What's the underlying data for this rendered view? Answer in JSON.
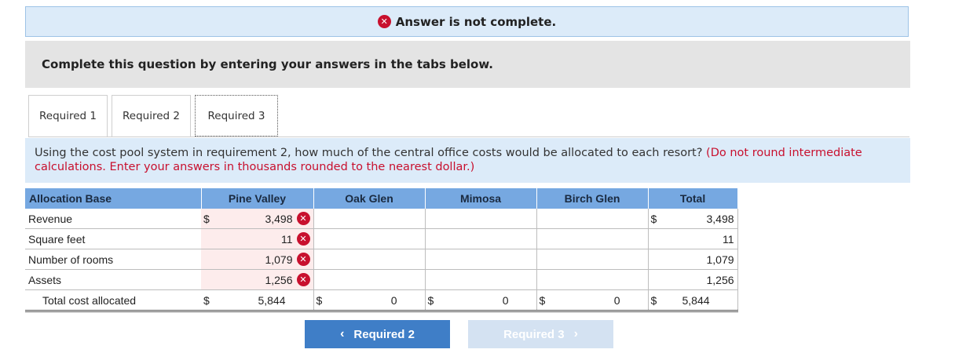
{
  "banner": {
    "text": "Answer is not complete."
  },
  "instruction": "Complete this question by entering your answers in the tabs below.",
  "tabs": [
    {
      "label": "Required 1"
    },
    {
      "label": "Required 2"
    },
    {
      "label": "Required 3",
      "active": true
    }
  ],
  "question": {
    "text": "Using the cost pool system in requirement 2, how much of the central office costs would be allocated to each resort?",
    "note": "(Do not round intermediate calculations. Enter your answers in thousands rounded to the nearest dollar.)"
  },
  "table": {
    "headers": [
      "Allocation Base",
      "Pine Valley",
      "Oak Glen",
      "Mimosa",
      "Birch Glen",
      "Total"
    ],
    "currency": "$",
    "rows": [
      {
        "label": "Revenue",
        "pine_valley": "3,498",
        "oak_glen": "",
        "mimosa": "",
        "birch_glen": "",
        "total": "3,498"
      },
      {
        "label": "Square feet",
        "pine_valley": "11",
        "oak_glen": "",
        "mimosa": "",
        "birch_glen": "",
        "total": "11"
      },
      {
        "label": "Number of rooms",
        "pine_valley": "1,079",
        "oak_glen": "",
        "mimosa": "",
        "birch_glen": "",
        "total": "1,079"
      },
      {
        "label": "Assets",
        "pine_valley": "1,256",
        "oak_glen": "",
        "mimosa": "",
        "birch_glen": "",
        "total": "1,256"
      }
    ],
    "total_row": {
      "label": "Total cost allocated",
      "pine_valley": "5,844",
      "oak_glen": "0",
      "mimosa": "0",
      "birch_glen": "0",
      "total": "5,844"
    }
  },
  "buttons": {
    "prev_label": "Required 2",
    "next_label": "Required 3"
  },
  "colors": {
    "error_red": "#c8102e",
    "header_blue": "#76a8e1",
    "banner_bg": "#dcebf9",
    "prev_button": "#3f7ec7",
    "next_button_disabled": "#d4e2f2"
  },
  "icons": {
    "incorrect": "x-circle-icon",
    "prev": "chevron-left-icon",
    "next": "chevron-right-icon"
  }
}
